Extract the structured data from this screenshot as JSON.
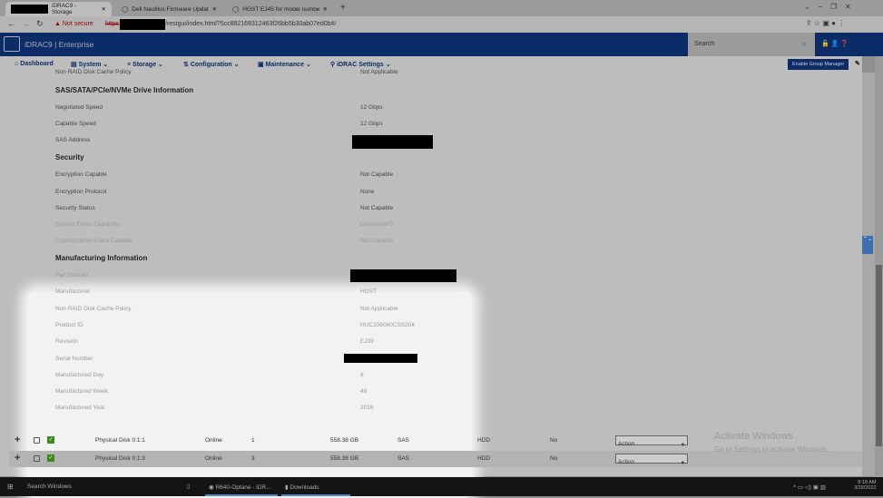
{
  "browser": {
    "tabs": [
      {
        "label": "iDRAC9 - Storage"
      },
      {
        "label": "Dell Nautilus Firmware Update U"
      },
      {
        "label": "HGST EJ45 for model number(s)"
      }
    ],
    "not_secure": "Not secure",
    "url_scheme": "https",
    "url": "/restgui/index.html?5cc882169312463f26bb5b30ab07ed0b#/"
  },
  "header": {
    "product": "iDRAC9",
    "edition": "Enterprise",
    "search_placeholder": "Search"
  },
  "nav": {
    "items": [
      {
        "label": "Dashboard"
      },
      {
        "label": "System"
      },
      {
        "label": "Storage"
      },
      {
        "label": "Configuration"
      },
      {
        "label": "Maintenance"
      },
      {
        "label": "iDRAC Settings"
      }
    ],
    "group_manager": "Enable Group Manager"
  },
  "details": {
    "cut_row": {
      "label": "Non RAID Disk Cache Policy",
      "value": "Not Applicable"
    },
    "drive_section": "SAS/SATA/PCIe/NVMe Drive Information",
    "drive_rows": [
      {
        "label": "Negotiated Speed",
        "value": "12 Gbps"
      },
      {
        "label": "Capable Speed",
        "value": "12 Gbps"
      },
      {
        "label": "SAS Address",
        "value": ""
      }
    ],
    "security_section": "Security",
    "security_rows": [
      {
        "label": "Encryption Capable",
        "value": "Not Capable"
      },
      {
        "label": "Encryption Protocol",
        "value": "None"
      },
      {
        "label": "Security Status",
        "value": "Not Capable"
      },
      {
        "label": "System Erase Capability",
        "value": "OverwritePD"
      },
      {
        "label": "Cryptographic Erase Capable",
        "value": "Not Capable"
      }
    ],
    "mfg_section": "Manufacturing Information",
    "mfg_rows": [
      {
        "label": "Part Number",
        "value": ""
      },
      {
        "label": "Manufacturer",
        "value": "HGST"
      },
      {
        "label": "Non RAID Disk Cache Policy",
        "value": "Not Applicable"
      },
      {
        "label": "Product ID",
        "value": "HUC156060CSS204"
      },
      {
        "label": "Revision",
        "value": "EJ39"
      },
      {
        "label": "Serial Number",
        "value": ""
      },
      {
        "label": "Manufactured Day",
        "value": "6"
      },
      {
        "label": "Manufactured Week",
        "value": "48"
      },
      {
        "label": "Manufactured Year",
        "value": "2016"
      }
    ]
  },
  "disks": [
    {
      "name": "Physical Disk 0:1:1",
      "state": "Online",
      "slot": "1",
      "size": "558.38 GB",
      "bus": "SAS",
      "media": "HDD",
      "hotspare": "No",
      "action": "Action"
    },
    {
      "name": "Physical Disk 0:1:3",
      "state": "Online",
      "slot": "3",
      "size": "558.38 GB",
      "bus": "SAS",
      "media": "HDD",
      "hotspare": "No",
      "action": "Action"
    }
  ],
  "watermark": {
    "title": "Activate Windows",
    "sub": "Go to Settings to activate Windows."
  },
  "taskbar": {
    "search": "Search Windows",
    "apps": [
      {
        "label": "R640-Optane - iDR..."
      },
      {
        "label": "Downloads"
      }
    ],
    "time": "8:18 AM",
    "date": "3/29/2022"
  },
  "colors": {
    "header": "#0b2c66",
    "ok": "#3a8a1a"
  }
}
